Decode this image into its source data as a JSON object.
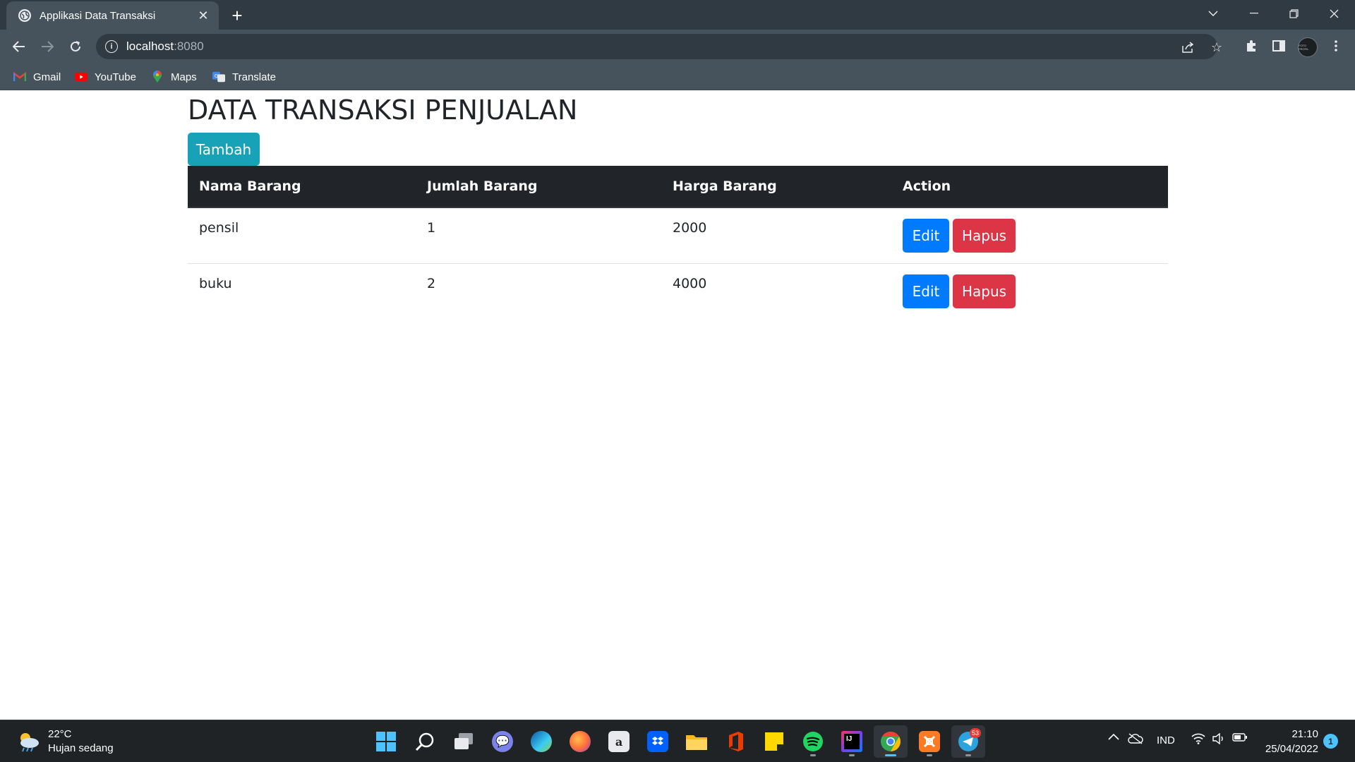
{
  "browser": {
    "tab_title": "Applikasi Data Transaksi",
    "url_host": "localhost",
    "url_port": ":8080",
    "profile_label": "FOTO PROFIL",
    "bookmarks": [
      {
        "label": "Gmail",
        "icon": "gmail-icon"
      },
      {
        "label": "YouTube",
        "icon": "youtube-icon"
      },
      {
        "label": "Maps",
        "icon": "maps-icon"
      },
      {
        "label": "Translate",
        "icon": "translate-icon"
      }
    ]
  },
  "page": {
    "title": "DATA TRANSAKSI PENJUALAN",
    "add_button": "Tambah",
    "table": {
      "headers": [
        "Nama Barang",
        "Jumlah Barang",
        "Harga Barang",
        "Action"
      ],
      "rows": [
        {
          "nama": "pensil",
          "jumlah": "1",
          "harga": "2000"
        },
        {
          "nama": "buku",
          "jumlah": "2",
          "harga": "4000"
        }
      ],
      "edit_label": "Edit",
      "delete_label": "Hapus"
    }
  },
  "taskbar": {
    "weather_temp": "22°C",
    "weather_desc": "Hujan sedang",
    "language": "IND",
    "time": "21:10",
    "date": "25/04/2022",
    "notification_count": "1",
    "telegram_badge": "53",
    "apps": [
      "start",
      "search",
      "task-view",
      "chat",
      "edge",
      "firefox",
      "amazon",
      "dropbox",
      "file-explorer",
      "office",
      "sticky-notes",
      "spotify",
      "intellij",
      "chrome",
      "xampp",
      "telegram"
    ]
  },
  "colors": {
    "add_button": "#17a2b8",
    "edit_button": "#007bff",
    "delete_button": "#dc3545",
    "table_header": "#212529"
  }
}
